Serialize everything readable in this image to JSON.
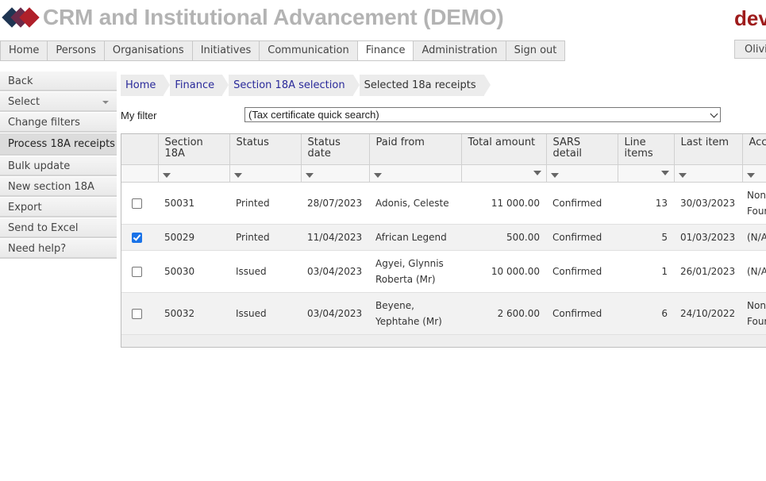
{
  "header": {
    "title": "CRM and Institutional Advancement (DEMO)",
    "brand": "dev",
    "user_button": "Olivi"
  },
  "nav": {
    "items": [
      {
        "label": "Home",
        "active": false
      },
      {
        "label": "Persons",
        "active": false
      },
      {
        "label": "Organisations",
        "active": false
      },
      {
        "label": "Initiatives",
        "active": false
      },
      {
        "label": "Communication",
        "active": false
      },
      {
        "label": "Finance",
        "active": true
      },
      {
        "label": "Administration",
        "active": false
      },
      {
        "label": "Sign out",
        "active": false
      }
    ]
  },
  "sidebar": {
    "items": [
      {
        "label": "Back"
      },
      {
        "label": "Select"
      },
      {
        "label": "Change filters"
      },
      {
        "label": "Process 18A receipts"
      },
      {
        "label": "Bulk update"
      },
      {
        "label": "New section 18A"
      },
      {
        "label": "Export"
      },
      {
        "label": "Send to Excel"
      },
      {
        "label": "Need help?"
      }
    ]
  },
  "breadcrumb": [
    "Home",
    "Finance",
    "Section 18A selection",
    "Selected 18a receipts"
  ],
  "filter": {
    "label": "My filter",
    "selected": "(Tax certificate quick search)"
  },
  "table": {
    "columns": [
      "Section 18A",
      "Status",
      "Status date",
      "Paid from",
      "Total amount",
      "SARS detail",
      "Line items",
      "Last item",
      "Acc"
    ],
    "rows": [
      {
        "checked": false,
        "section": "50031",
        "status": "Printed",
        "status_date": "28/07/2023",
        "paid_from": "Adonis, Celeste",
        "total": "11 000.00",
        "sars": "Confirmed",
        "line_items": "13",
        "last_item": "30/03/2023",
        "acc": "Non Four"
      },
      {
        "checked": true,
        "section": "50029",
        "status": "Printed",
        "status_date": "11/04/2023",
        "paid_from": "African Legend",
        "total": "500.00",
        "sars": "Confirmed",
        "line_items": "5",
        "last_item": "01/03/2023",
        "acc": "(N/A"
      },
      {
        "checked": false,
        "section": "50030",
        "status": "Issued",
        "status_date": "03/04/2023",
        "paid_from": "Agyei, Glynnis Roberta (Mr)",
        "total": "10 000.00",
        "sars": "Confirmed",
        "line_items": "1",
        "last_item": "26/01/2023",
        "acc": "(N/A"
      },
      {
        "checked": false,
        "section": "50032",
        "status": "Issued",
        "status_date": "03/04/2023",
        "paid_from": "Beyene, Yephtahe (Mr)",
        "total": "2 600.00",
        "sars": "Confirmed",
        "line_items": "6",
        "last_item": "24/10/2022",
        "acc": "Non Four"
      }
    ]
  },
  "colors": {
    "title_gray": "#b3b3b3",
    "brand_red": "#9e1b1b",
    "link_blue": "#2a2a9a",
    "check_blue": "#1a73e8"
  }
}
